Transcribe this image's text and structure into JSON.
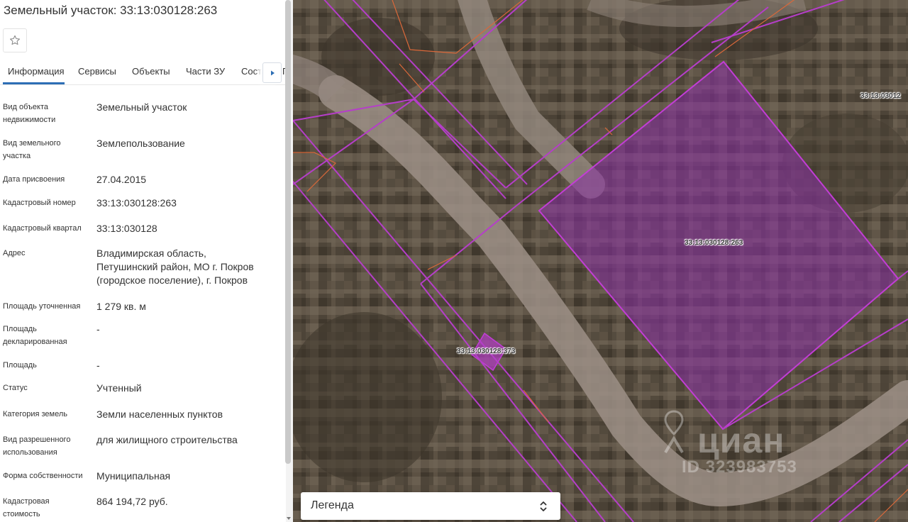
{
  "panel": {
    "title": "Земельный участок: 33:13:030128:263",
    "favorite_icon": "star-outline-icon",
    "tabs": [
      {
        "label": "Информация",
        "active": true
      },
      {
        "label": "Сервисы",
        "active": false
      },
      {
        "label": "Объекты",
        "active": false
      },
      {
        "label": "Части ЗУ",
        "active": false
      },
      {
        "label": "Соста",
        "active": false
      },
      {
        "label": "Г",
        "active": false
      }
    ],
    "tabs_scroll_icon": "caret-right-icon",
    "fields": [
      {
        "label": "Вид объекта недвижимости",
        "value": "Земельный участок"
      },
      {
        "label": "Вид земельного участка",
        "value": "Землепользование"
      },
      {
        "label": "Дата присвоения",
        "value": "27.04.2015"
      },
      {
        "label": "Кадастровый номер",
        "value": "33:13:030128:263"
      },
      {
        "label": "Кадастровый квартал",
        "value": "33:13:030128"
      },
      {
        "label": "Адрес",
        "value": "Владимирская область, Петушинский район, МО г. Покров (городское поселение), г. Покров"
      },
      {
        "label": "Площадь уточненная",
        "value": "1 279 кв. м"
      },
      {
        "label": "Площадь декларированная",
        "value": "-"
      },
      {
        "label": "Площадь",
        "value": "-"
      },
      {
        "label": "Статус",
        "value": "Учтенный"
      },
      {
        "label": "Категория земель",
        "value": "Земли населенных пунктов"
      },
      {
        "label": "Вид разрешенного использования",
        "value": "для жилищного строительства"
      },
      {
        "label": "Форма собственности",
        "value": "Муниципальная"
      },
      {
        "label": "Кадастровая стоимость",
        "value": "864 194,72 руб."
      }
    ]
  },
  "map": {
    "parcel_labels": [
      "33:13:030128:263",
      "33:13:030128:373",
      "33:13:03012"
    ],
    "watermark": {
      "brand": "циан",
      "id": "ID 323983753",
      "icon": "location-pin-icon"
    },
    "legend": {
      "label": "Легенда",
      "icon": "chevron-up-down-icon"
    },
    "colors": {
      "parcel_border": "#b03bc2",
      "parcel_fill": "#8a2fa6",
      "quarter_border": "#e0703a"
    }
  }
}
